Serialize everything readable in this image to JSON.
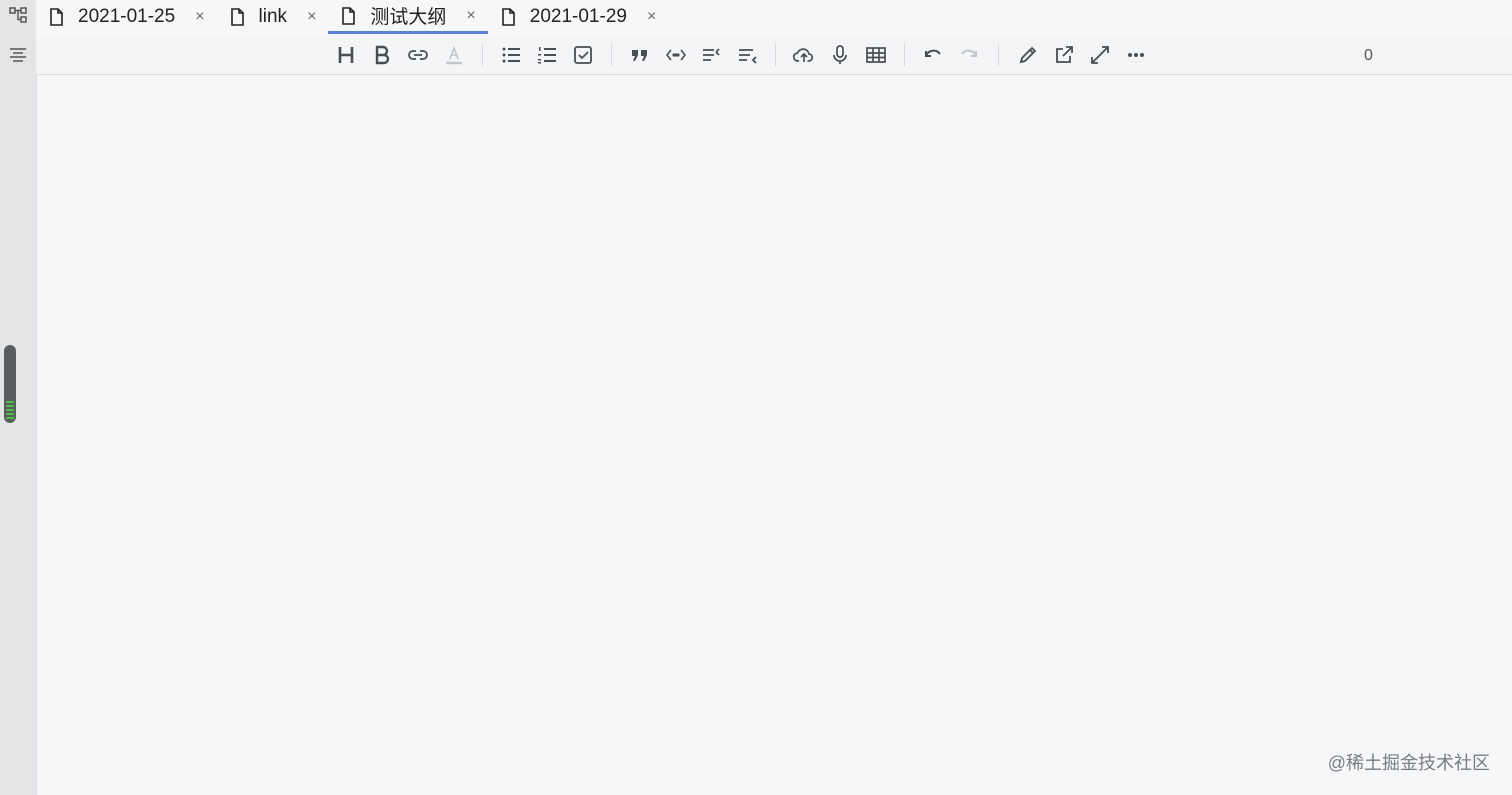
{
  "tabs": [
    {
      "label": "2021-01-25",
      "icon": "document-icon",
      "close": "×"
    },
    {
      "label": "link",
      "icon": "document-icon",
      "close": "×"
    },
    {
      "label": "测试大纲",
      "icon": "document-icon",
      "close": "×",
      "active": true
    },
    {
      "label": "2021-01-29",
      "icon": "document-icon",
      "close": "×"
    }
  ],
  "toolbar": {
    "groups": [
      [
        "heading-icon",
        "bold-icon",
        "link-icon",
        "font-color-icon"
      ],
      [
        "bullet-list-icon",
        "ordered-list-icon",
        "checkbox-icon"
      ],
      [
        "quote-icon",
        "code-icon",
        "outdent-icon",
        "indent-icon"
      ],
      [
        "upload-icon",
        "microphone-icon",
        "table-icon"
      ],
      [
        "undo-icon",
        "redo-icon"
      ],
      [
        "edit-icon",
        "open-external-icon",
        "fullscreen-icon",
        "more-icon"
      ]
    ],
    "counter": "0"
  },
  "rail": {
    "top_icon": "outline-tree-icon",
    "second_icon": "align-center-icon"
  },
  "watermark": "@稀土掘金技术社区",
  "colors": {
    "accent": "#5b7fd6",
    "background": "#f6f7f9",
    "rail": "#e3e5e7"
  }
}
